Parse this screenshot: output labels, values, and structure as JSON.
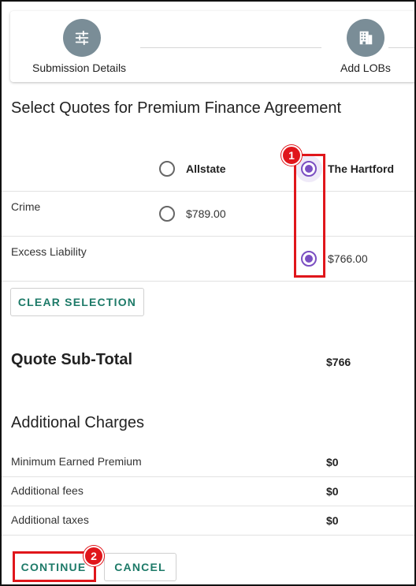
{
  "stepper": {
    "steps": [
      {
        "label": "Submission Details",
        "icon": "sliders-icon"
      },
      {
        "label": "Add LOBs",
        "icon": "building-icon"
      }
    ]
  },
  "quotes": {
    "title": "Select Quotes for Premium Finance Agreement",
    "carriers": [
      {
        "name": "Allstate",
        "selected": false
      },
      {
        "name": "The Hartford",
        "selected": true
      }
    ],
    "rows": [
      {
        "label": "Crime",
        "allstate": "$789.00",
        "hartford": ""
      },
      {
        "label": "Excess Liability",
        "allstate": "",
        "hartford": "$766.00",
        "hartford_selected": true
      }
    ],
    "clear_label": "CLEAR SELECTION"
  },
  "subtotal": {
    "label": "Quote Sub-Total",
    "value": "$766"
  },
  "charges": {
    "title": "Additional Charges",
    "rows": [
      {
        "label": "Minimum Earned Premium",
        "value": "$0"
      },
      {
        "label": "Additional fees",
        "value": "$0"
      },
      {
        "label": "Additional taxes",
        "value": "$0"
      }
    ]
  },
  "actions": {
    "continue_label": "CONTINUE",
    "cancel_label": "CANCEL"
  },
  "annotations": {
    "badge_1": "1",
    "badge_2": "2"
  },
  "colors": {
    "accent_teal": "#1d7a68",
    "radio_purple": "#7b4fc2",
    "annotation_red": "#e0161b",
    "step_gray": "#7a8d97"
  }
}
